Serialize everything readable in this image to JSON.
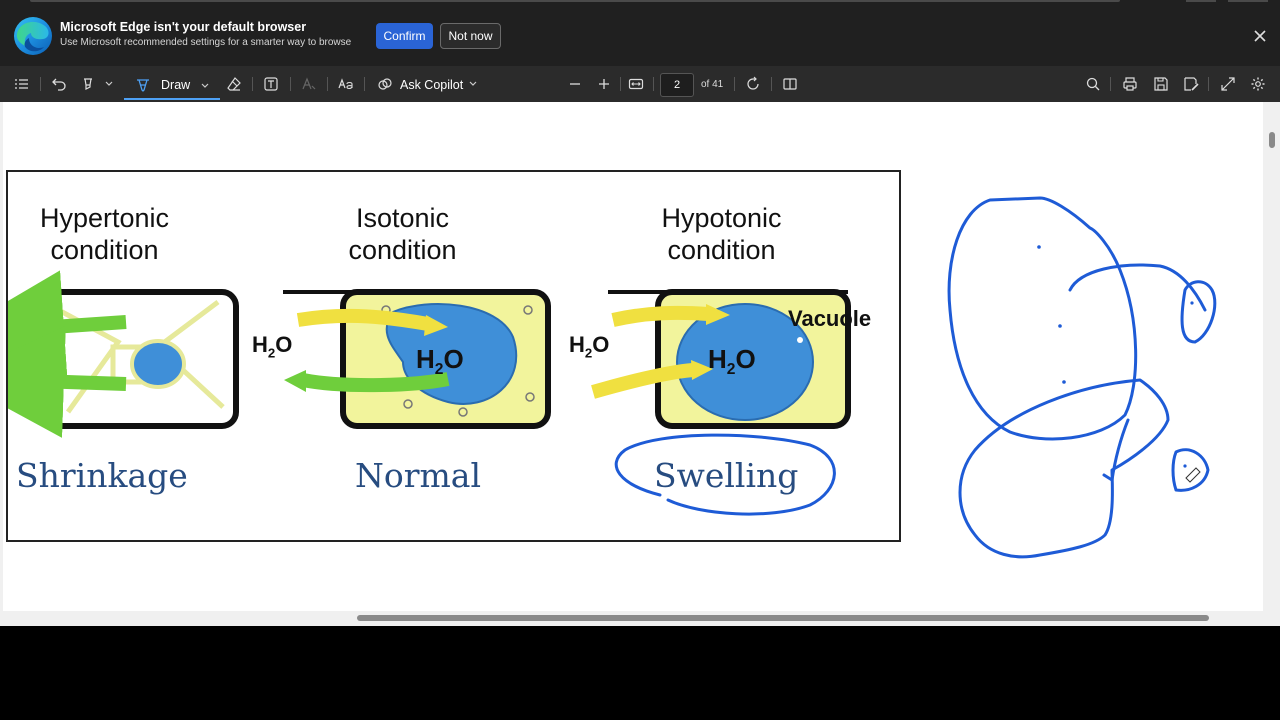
{
  "banner": {
    "title": "Microsoft Edge isn't your default browser",
    "subtitle": "Use Microsoft recommended settings for a smarter way to browse",
    "confirm_label": "Confirm",
    "notnow_label": "Not now"
  },
  "toolbar": {
    "draw_label": "Draw",
    "copilot_label": "Ask Copilot",
    "page_current": "2",
    "page_total": "of 41"
  },
  "figure": {
    "conditions": [
      {
        "line1": "Hypertonic",
        "line2": "condition",
        "outcome": "Shrinkage"
      },
      {
        "line1": "Isotonic",
        "line2": "condition",
        "outcome": "Normal"
      },
      {
        "line1": "Hypotonic",
        "line2": "condition",
        "outcome": "Swelling"
      }
    ],
    "h2o_main": "H",
    "h2o_sub": "2",
    "h2o_end": "O",
    "vacuole_label": "Vacuole"
  },
  "colors": {
    "banner_bg": "#202020",
    "toolbar_bg": "#2b2b2b",
    "accent_blue": "#2a64d6",
    "ink_blue": "#1e5bd6",
    "outcome_text": "#274c80"
  },
  "icons": [
    "edge-logo-icon",
    "close-icon",
    "contents-icon",
    "undo-icon",
    "highlight-icon",
    "draw-icon",
    "eraser-icon",
    "textbox-icon",
    "text-format-icon",
    "read-aloud-icon",
    "copilot-icon",
    "zoom-out-icon",
    "zoom-in-icon",
    "fit-page-icon",
    "rotate-icon",
    "page-view-icon",
    "search-icon",
    "print-icon",
    "save-icon",
    "save-as-icon",
    "fullscreen-icon",
    "settings-icon"
  ]
}
